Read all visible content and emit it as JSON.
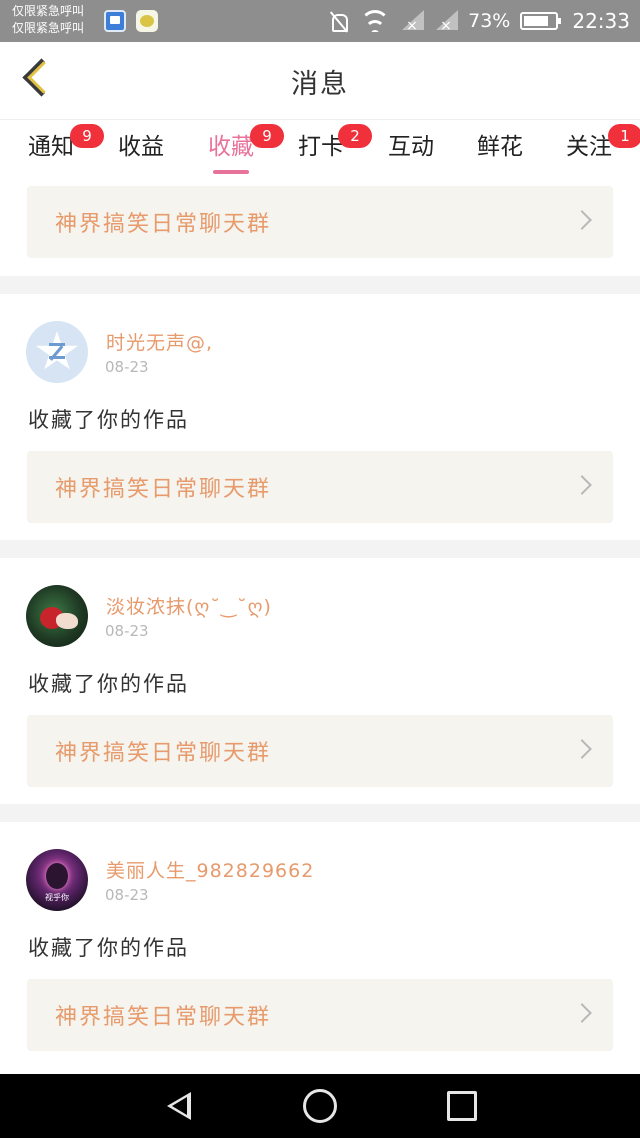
{
  "status_bar": {
    "carrier_line1": "仅限紧急呼叫",
    "carrier_line2": "仅限紧急呼叫",
    "battery": "73%",
    "time": "22:33"
  },
  "header": {
    "title": "消息",
    "back_icon": "back-chevron-icon"
  },
  "tabs": [
    {
      "label": "通知",
      "badge": "9",
      "active": false
    },
    {
      "label": "收益",
      "badge": "",
      "active": false
    },
    {
      "label": "收藏",
      "badge": "9",
      "active": true
    },
    {
      "label": "打卡",
      "badge": "2",
      "active": false
    },
    {
      "label": "互动",
      "badge": "",
      "active": false
    },
    {
      "label": "鲜花",
      "badge": "",
      "active": false
    },
    {
      "label": "关注",
      "badge": "1",
      "active": false
    }
  ],
  "accent_color": "#e8739a",
  "badge_color": "#f0303a",
  "name_color": "#e79a6b",
  "first_group": {
    "group": "神界搞笑日常聊天群"
  },
  "items": [
    {
      "user": "时光无声@,",
      "date": "08-23",
      "action": "收藏了你的作品",
      "group": "神界搞笑日常聊天群"
    },
    {
      "user": "淡妆浓抹(ღ˘‿˘ღ)",
      "date": "08-23",
      "action": "收藏了你的作品",
      "group": "神界搞笑日常聊天群"
    },
    {
      "user": "美丽人生_982829662",
      "date": "08-23",
      "action": "收藏了你的作品",
      "group": "神界搞笑日常聊天群"
    }
  ],
  "avatar_tag": "视乎你"
}
